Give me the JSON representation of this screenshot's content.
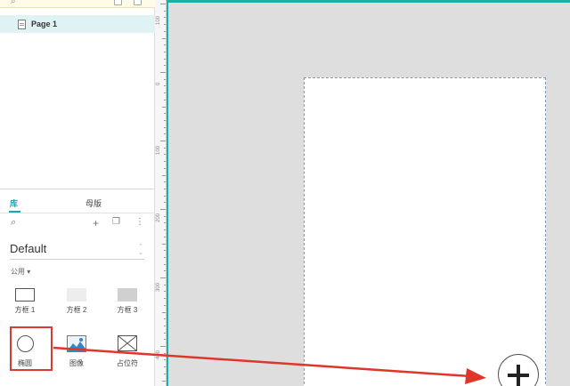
{
  "pages": [
    {
      "label": "Page 1"
    }
  ],
  "library": {
    "tabs": [
      {
        "label": "库"
      },
      {
        "label": "母版"
      }
    ],
    "name": "Default",
    "group": "公用 ▾",
    "widgets": [
      {
        "label": "方框 1"
      },
      {
        "label": "方框 2"
      },
      {
        "label": "方框 3"
      },
      {
        "label": "椭圆"
      },
      {
        "label": "图像"
      },
      {
        "label": "占位符"
      }
    ]
  },
  "ruler": {
    "labels": [
      "100",
      "0",
      "100",
      "200",
      "300",
      "400"
    ]
  },
  "colors": {
    "accent": "#1aa6ad",
    "highlight": "#d93a31",
    "canvas_bg": "#dedede"
  },
  "icons": [
    "search-icon",
    "add-icon",
    "window-icon",
    "more-icon",
    "chevron-updown-icon",
    "image-icon",
    "placeholder-icon",
    "plus-icon"
  ]
}
